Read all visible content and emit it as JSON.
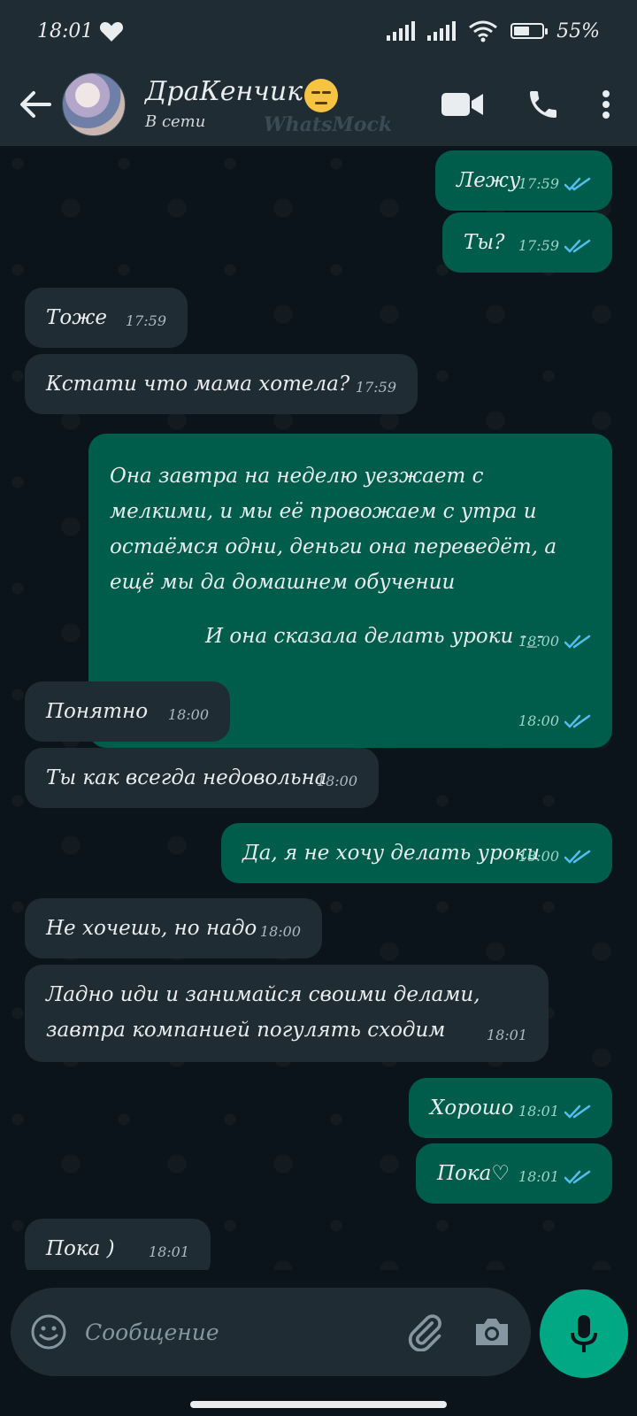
{
  "status_bar": {
    "time": "18:01",
    "battery": "55%",
    "battery_level": 0.55
  },
  "header": {
    "contact_name": "ДраКенчик",
    "contact_status": "В сети",
    "watermark": "WhatsMock"
  },
  "messages": [
    {
      "dir": "out",
      "text": "Лежу",
      "time": "17:59"
    },
    {
      "dir": "out",
      "text": "Ты?",
      "time": "17:59"
    },
    {
      "dir": "in",
      "text": "Тоже",
      "time": "17:59"
    },
    {
      "dir": "in",
      "text": "Кстати что мама хотела?",
      "time": "17:59"
    },
    {
      "dir": "out",
      "text": "Она завтра на неделю уезжает с мелкими, и мы её провожаем с утра и остаёмся одни, деньги она переведёт, а ещё мы да домашнем обучении",
      "time": "18:00"
    },
    {
      "dir": "out",
      "text": "И она сказала делать уроки -_-",
      "time": "18:00"
    },
    {
      "dir": "in",
      "text": "Понятно",
      "time": "18:00"
    },
    {
      "dir": "in",
      "text": "Ты как всегда недовольна",
      "time": "18:00"
    },
    {
      "dir": "out",
      "text": "Да, я не хочу делать уроки",
      "time": "18:00"
    },
    {
      "dir": "in",
      "text": "Не хочешь, но надо",
      "time": "18:00"
    },
    {
      "dir": "in",
      "text": "Ладно иди и занимайся своими делами, завтра компанией погулять сходим",
      "time": "18:01"
    },
    {
      "dir": "out",
      "text": "Хорошо",
      "time": "18:01"
    },
    {
      "dir": "out",
      "text": "Пока♡",
      "time": "18:01"
    },
    {
      "dir": "in",
      "text": "Пока )",
      "time": "18:01"
    }
  ],
  "composer": {
    "placeholder": "Сообщение"
  },
  "icons": {
    "back": "arrow-left-icon",
    "video": "video-call-icon",
    "call": "phone-icon",
    "menu": "more-vert-icon",
    "emoji": "emoji-icon",
    "attach": "paperclip-icon",
    "camera": "camera-icon",
    "mic": "mic-icon",
    "read": "double-check-icon"
  },
  "colors": {
    "outgoing": "#005c4b",
    "incoming": "#202c33",
    "accent": "#00a884",
    "read_ticks": "#53bdeb"
  }
}
